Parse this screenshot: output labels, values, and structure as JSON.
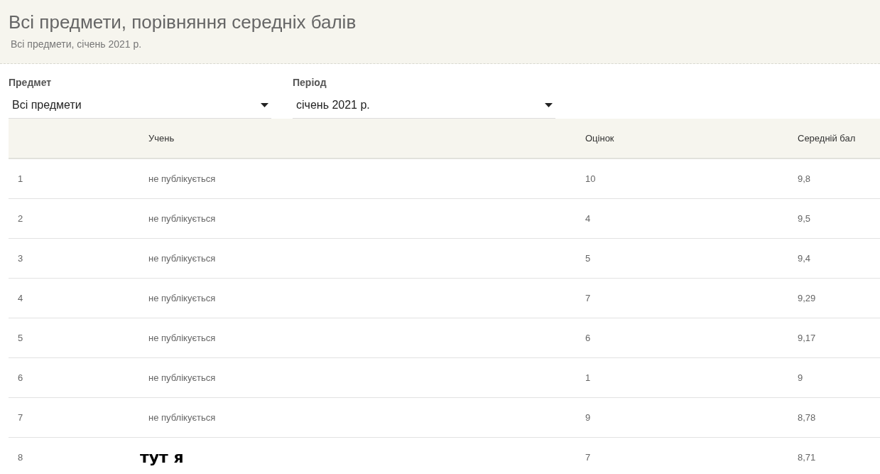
{
  "header": {
    "title": "Всі предмети, порівняння середніх балів",
    "subtitle": "Всі предмети, січень 2021 р."
  },
  "filters": [
    {
      "label": "Предмет",
      "value": "Всі предмети"
    },
    {
      "label": "Період",
      "value": "січень 2021 р."
    }
  ],
  "table": {
    "columns": [
      "Учень",
      "Оцінок",
      "Середній бал"
    ],
    "rows": [
      {
        "rank": "1",
        "student": "не публікується",
        "kind": "plain",
        "count": "10",
        "average": "9,8"
      },
      {
        "rank": "2",
        "student": "не публікується",
        "kind": "plain",
        "count": "4",
        "average": "9,5"
      },
      {
        "rank": "3",
        "student": "не публікується",
        "kind": "plain",
        "count": "5",
        "average": "9,4"
      },
      {
        "rank": "4",
        "student": "не публікується",
        "kind": "plain",
        "count": "7",
        "average": "9,29"
      },
      {
        "rank": "5",
        "student": "не публікується",
        "kind": "plain",
        "count": "6",
        "average": "9,17"
      },
      {
        "rank": "6",
        "student": "не публікується",
        "kind": "plain",
        "count": "1",
        "average": "9"
      },
      {
        "rank": "7",
        "student": "не публікується",
        "kind": "plain",
        "count": "9",
        "average": "8,78"
      },
      {
        "rank": "8",
        "student": "тут я",
        "kind": "handwritten",
        "count": "7",
        "average": "8,71"
      }
    ]
  }
}
